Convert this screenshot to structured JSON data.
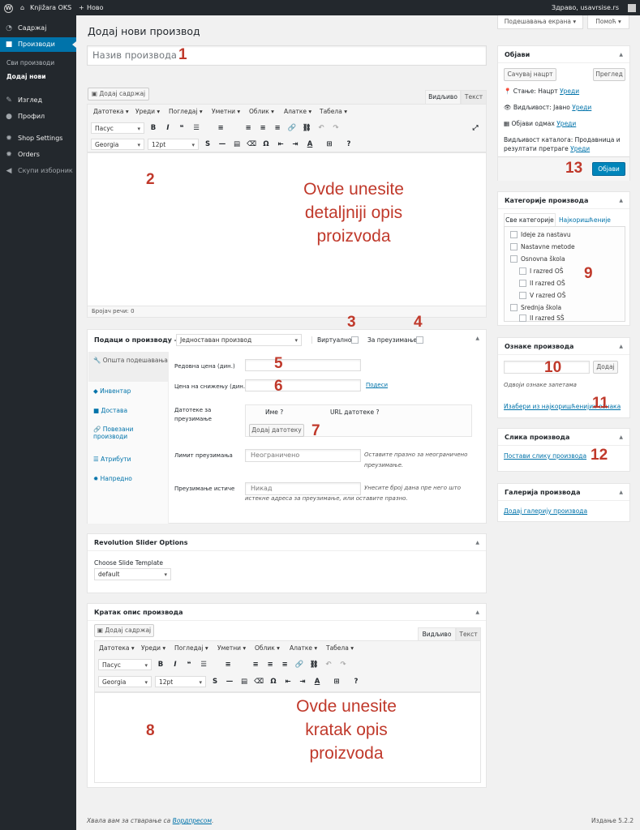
{
  "admin_bar": {
    "site_name": "Knjižara OKS",
    "new_label": "Ново",
    "greeting": "Здраво, usavrsise.rs"
  },
  "sidebar": {
    "items": [
      {
        "label": "Садржај",
        "icon": "dashboard-icon"
      },
      {
        "label": "Производи",
        "icon": "product-box-icon"
      },
      {
        "label": "Изглед",
        "icon": "paintbrush-icon"
      },
      {
        "label": "Профил",
        "icon": "user-icon"
      },
      {
        "label": "Shop Settings",
        "icon": "gear-icon"
      },
      {
        "label": "Orders",
        "icon": "gear-icon"
      },
      {
        "label": "Скупи изборник",
        "icon": "collapse-icon"
      }
    ],
    "subitems": [
      "Сви производи",
      "Додај нови"
    ]
  },
  "screen_options": "Подешавања екрана",
  "help": "Помоћ",
  "page_title": "Додај нови производ",
  "title_placeholder": "Назив производа",
  "annotations": [
    "1",
    "2",
    "3",
    "4",
    "5",
    "6",
    "7",
    "8",
    "9",
    "10",
    "11",
    "12",
    "13"
  ],
  "editor": {
    "add_media": "Додај садржај",
    "tab_visual": "Видљиво",
    "tab_text": "Текст",
    "menus": [
      "Датотека",
      "Уреди",
      "Погледај",
      "Уметни",
      "Облик",
      "Алатке",
      "Табела"
    ],
    "format_select": "Пасус",
    "font_select": "Georgia",
    "size_select": "12pt",
    "overlay_lines": [
      "Ovde unesite",
      "detaljniji opis",
      "proizvoda"
    ],
    "word_count": "Бројач речи: 0"
  },
  "product_data": {
    "title": "Подаци о производу —",
    "type": "Једноставан производ",
    "virtual_label": "Виртуално:",
    "downloadable_label": "За преузимање:",
    "tabs": [
      "Општа подешавања",
      "Инвентар",
      "Достава",
      "Повезани производи",
      "Атрибути",
      "Напредно"
    ],
    "regular_price_label": "Редовна цена (дин.)",
    "sale_price_label": "Цена на снижењу (дин.)",
    "schedule_link": "Подеси",
    "downloads_label": "Датотеке за преузимање",
    "col_name": "Име",
    "col_url": "URL датотеке",
    "add_file": "Додај датотеку",
    "download_limit_label": "Лимит преузимања",
    "download_limit_placeholder": "Неограничено",
    "download_limit_hint": "Оставите празно за неограничено преузимање.",
    "download_expiry_label": "Преузимање истиче",
    "download_expiry_placeholder": "Никад",
    "download_expiry_hint": "Унесите број дана пре него што истекне адреса за преузимање, или оставите празно."
  },
  "revslider": {
    "title": "Revolution Slider Options",
    "label": "Choose Slide Template",
    "value": "default"
  },
  "short_desc": {
    "title": "Кратак опис производа",
    "overlay_lines": [
      "Ovde unesite",
      "kratak opis",
      "proizvoda"
    ]
  },
  "publish": {
    "title": "Објави",
    "save_draft": "Сачувај нацрт",
    "preview": "Преглед",
    "status": "Стање: Нацрт",
    "visibility": "Видљивост: Јавно",
    "publish_time": "Објави одмах",
    "edit": "Уреди",
    "catalog_visibility": "Видљивост каталога: Продавница и резултати претраге",
    "publish_button": "Објави"
  },
  "categories": {
    "title": "Категорије производа",
    "tab_all": "Све категорије",
    "tab_popular": "Најкоришћеније",
    "items": [
      {
        "label": "Ideje za nastavu",
        "level": 0
      },
      {
        "label": "Nastavne metode",
        "level": 0
      },
      {
        "label": "Osnovna škola",
        "level": 0
      },
      {
        "label": "I razred OŠ",
        "level": 1
      },
      {
        "label": "II razred OŠ",
        "level": 1
      },
      {
        "label": "V razred OŠ",
        "level": 1
      },
      {
        "label": "Srednja škola",
        "level": 0
      },
      {
        "label": "II razred SŠ",
        "level": 1
      }
    ]
  },
  "tags": {
    "title": "Ознаке производа",
    "add": "Додај",
    "hint": "Одвоји ознаке запетама",
    "popular_link": "Изабери из најкоришћенијих ознака"
  },
  "product_image": {
    "title": "Слика производа",
    "link": "Постави слику производа"
  },
  "gallery": {
    "title": "Галерија производа",
    "link": "Додај галерију производа"
  },
  "footer": {
    "thanks": "Хвала вам за стварање са",
    "wp_link": "Вордпресом",
    "version": "Издање 5.2.2"
  }
}
